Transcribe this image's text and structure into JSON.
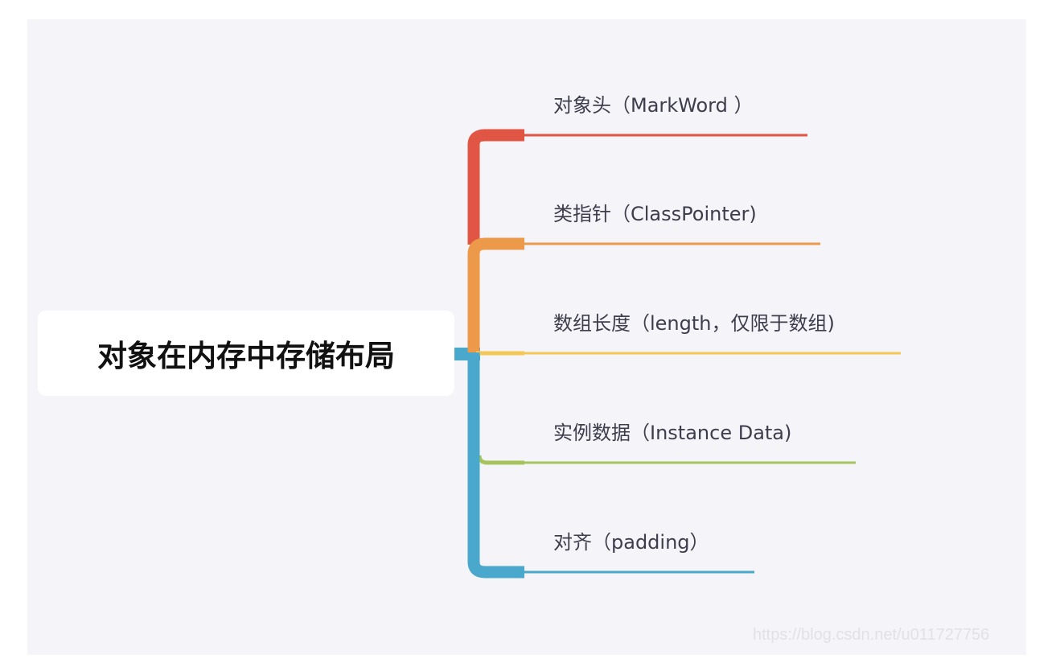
{
  "root": {
    "label": "对象在内存中存储布局"
  },
  "branches": [
    {
      "label": "对象头（MarkWord ）",
      "color": "#e05544"
    },
    {
      "label": "类指针（ClassPointer)",
      "color": "#ec9a4a"
    },
    {
      "label": "数组长度（length，仅限于数组)",
      "color": "#f5c855"
    },
    {
      "label": "实例数据（Instance Data)",
      "color": "#a5c45c"
    },
    {
      "label": "对齐（padding）",
      "color": "#4aa8cd"
    }
  ],
  "watermark": "https://blog.csdn.net/u011727756"
}
